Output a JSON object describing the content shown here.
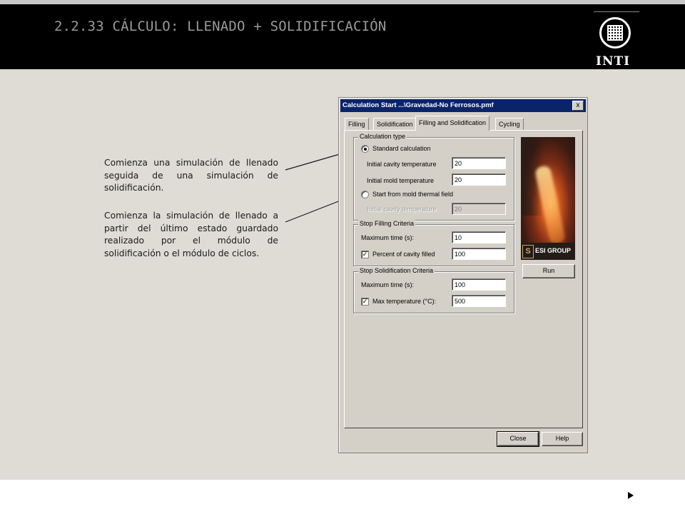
{
  "slide": {
    "title": "2.2.33 CÁLCULO: LLENADO + SOLIDIFICACIÓN",
    "logo_text": "INTI"
  },
  "annotations": [
    "Comienza una simulación de llenado seguida de una simulación de solidificación.",
    "Comienza la simulación de llenado a partir del último estado guardado realizado por el módulo de solidificación o el módulo de ciclos."
  ],
  "dialog": {
    "title": "Calculation Start ...\\Gravedad-No Ferrosos.pmf",
    "close_glyph": "x",
    "tabs": [
      "Filling",
      "Solidification",
      "Filling and Solidification",
      "Cycling"
    ],
    "active_tab": "Filling and Solidification",
    "calculation_type": {
      "label": "Calculation type",
      "option_standard": "Standard calculation",
      "standard_selected": true,
      "initial_cavity_temperature_label": "Initial cavity temperature",
      "initial_cavity_temperature": "20",
      "initial_mold_temperature_label": "Initial mold temperature",
      "initial_mold_temperature": "20",
      "option_mold_field": "Start from mold thermal field",
      "mold_field_selected": false,
      "mold_field_cavity_temperature_label": "Initial cavity temperature",
      "mold_field_cavity_temperature": "20"
    },
    "stop_filling": {
      "label": "Stop Filling Criteria",
      "max_time_label": "Maximum time (s):",
      "max_time": "10",
      "percent_label": "Percent of cavity filled",
      "percent_checked": true,
      "percent": "100"
    },
    "stop_solidification": {
      "label": "Stop Solidification Criteria",
      "max_time_label": "Maximum time (s):",
      "max_time": "100",
      "max_temp_label": "Max temperature (°C):",
      "max_temp_checked": true,
      "max_temp": "500"
    },
    "banner_logo_letter": "S",
    "banner_logo_text": "ESI GROUP",
    "run_label": "Run",
    "close_label": "Close",
    "help_label": "Help",
    "check_glyph": "✓"
  },
  "colors": {
    "header_bg": "#000000",
    "title_color": "#9a9a9a",
    "content_bg": "#dedcd5",
    "dialog_face": "#d4d0c8",
    "titlebar_bg": "#0a246a"
  }
}
